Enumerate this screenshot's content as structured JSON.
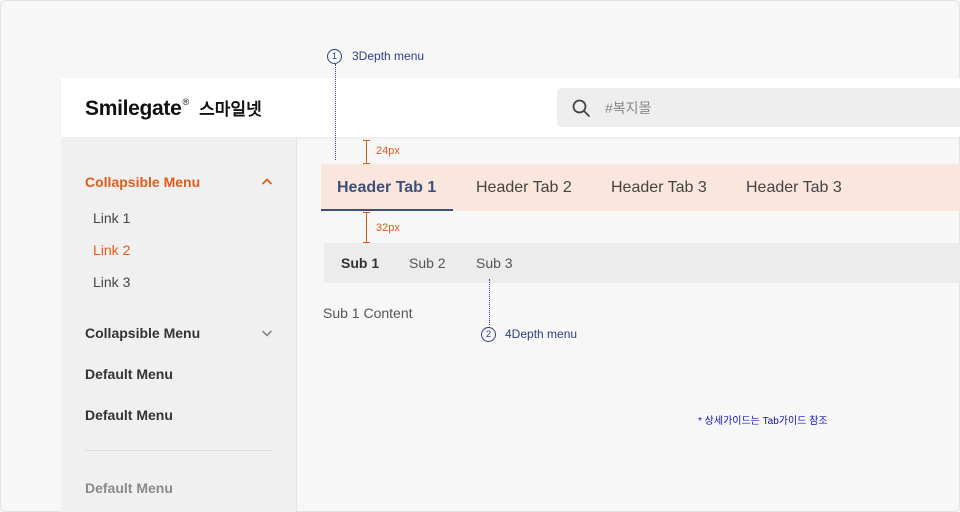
{
  "header": {
    "logo_word": "Smilegate",
    "logo_reg": "®",
    "logo_kr": "스마일넷",
    "search_placeholder": "#복지몰"
  },
  "sidebar": {
    "items": [
      {
        "label": "Collapsible Menu",
        "state": "expanded",
        "active": true
      },
      {
        "label": "Collapsible Menu",
        "state": "collapsed"
      },
      {
        "label": "Default Menu"
      },
      {
        "label": "Default Menu"
      },
      {
        "label": "Default Menu",
        "muted": true
      }
    ],
    "links": [
      {
        "label": "Link 1"
      },
      {
        "label": "Link 2",
        "active": true
      },
      {
        "label": "Link 3"
      }
    ]
  },
  "tabs": {
    "header_tabs": [
      "Header Tab 1",
      "Header Tab 2",
      "Header Tab 3",
      "Header Tab 3"
    ],
    "sub_tabs": [
      "Sub 1",
      "Sub 2",
      "Sub 3"
    ],
    "sub_content": "Sub 1 Content"
  },
  "annotations": {
    "a1_num": "1",
    "a1_text": "3Depth menu",
    "a2_num": "2",
    "a2_text": "4Depth menu",
    "m1": "24px",
    "m2": "32px",
    "note": "* 상세가이드는 Tab가이드 참조"
  },
  "colors": {
    "accent_orange": "#e35b1a",
    "tab_active_navy": "#3e4f7a",
    "tabbar_bg": "#fae6dc",
    "annotation_blue": "#2f3f80"
  }
}
